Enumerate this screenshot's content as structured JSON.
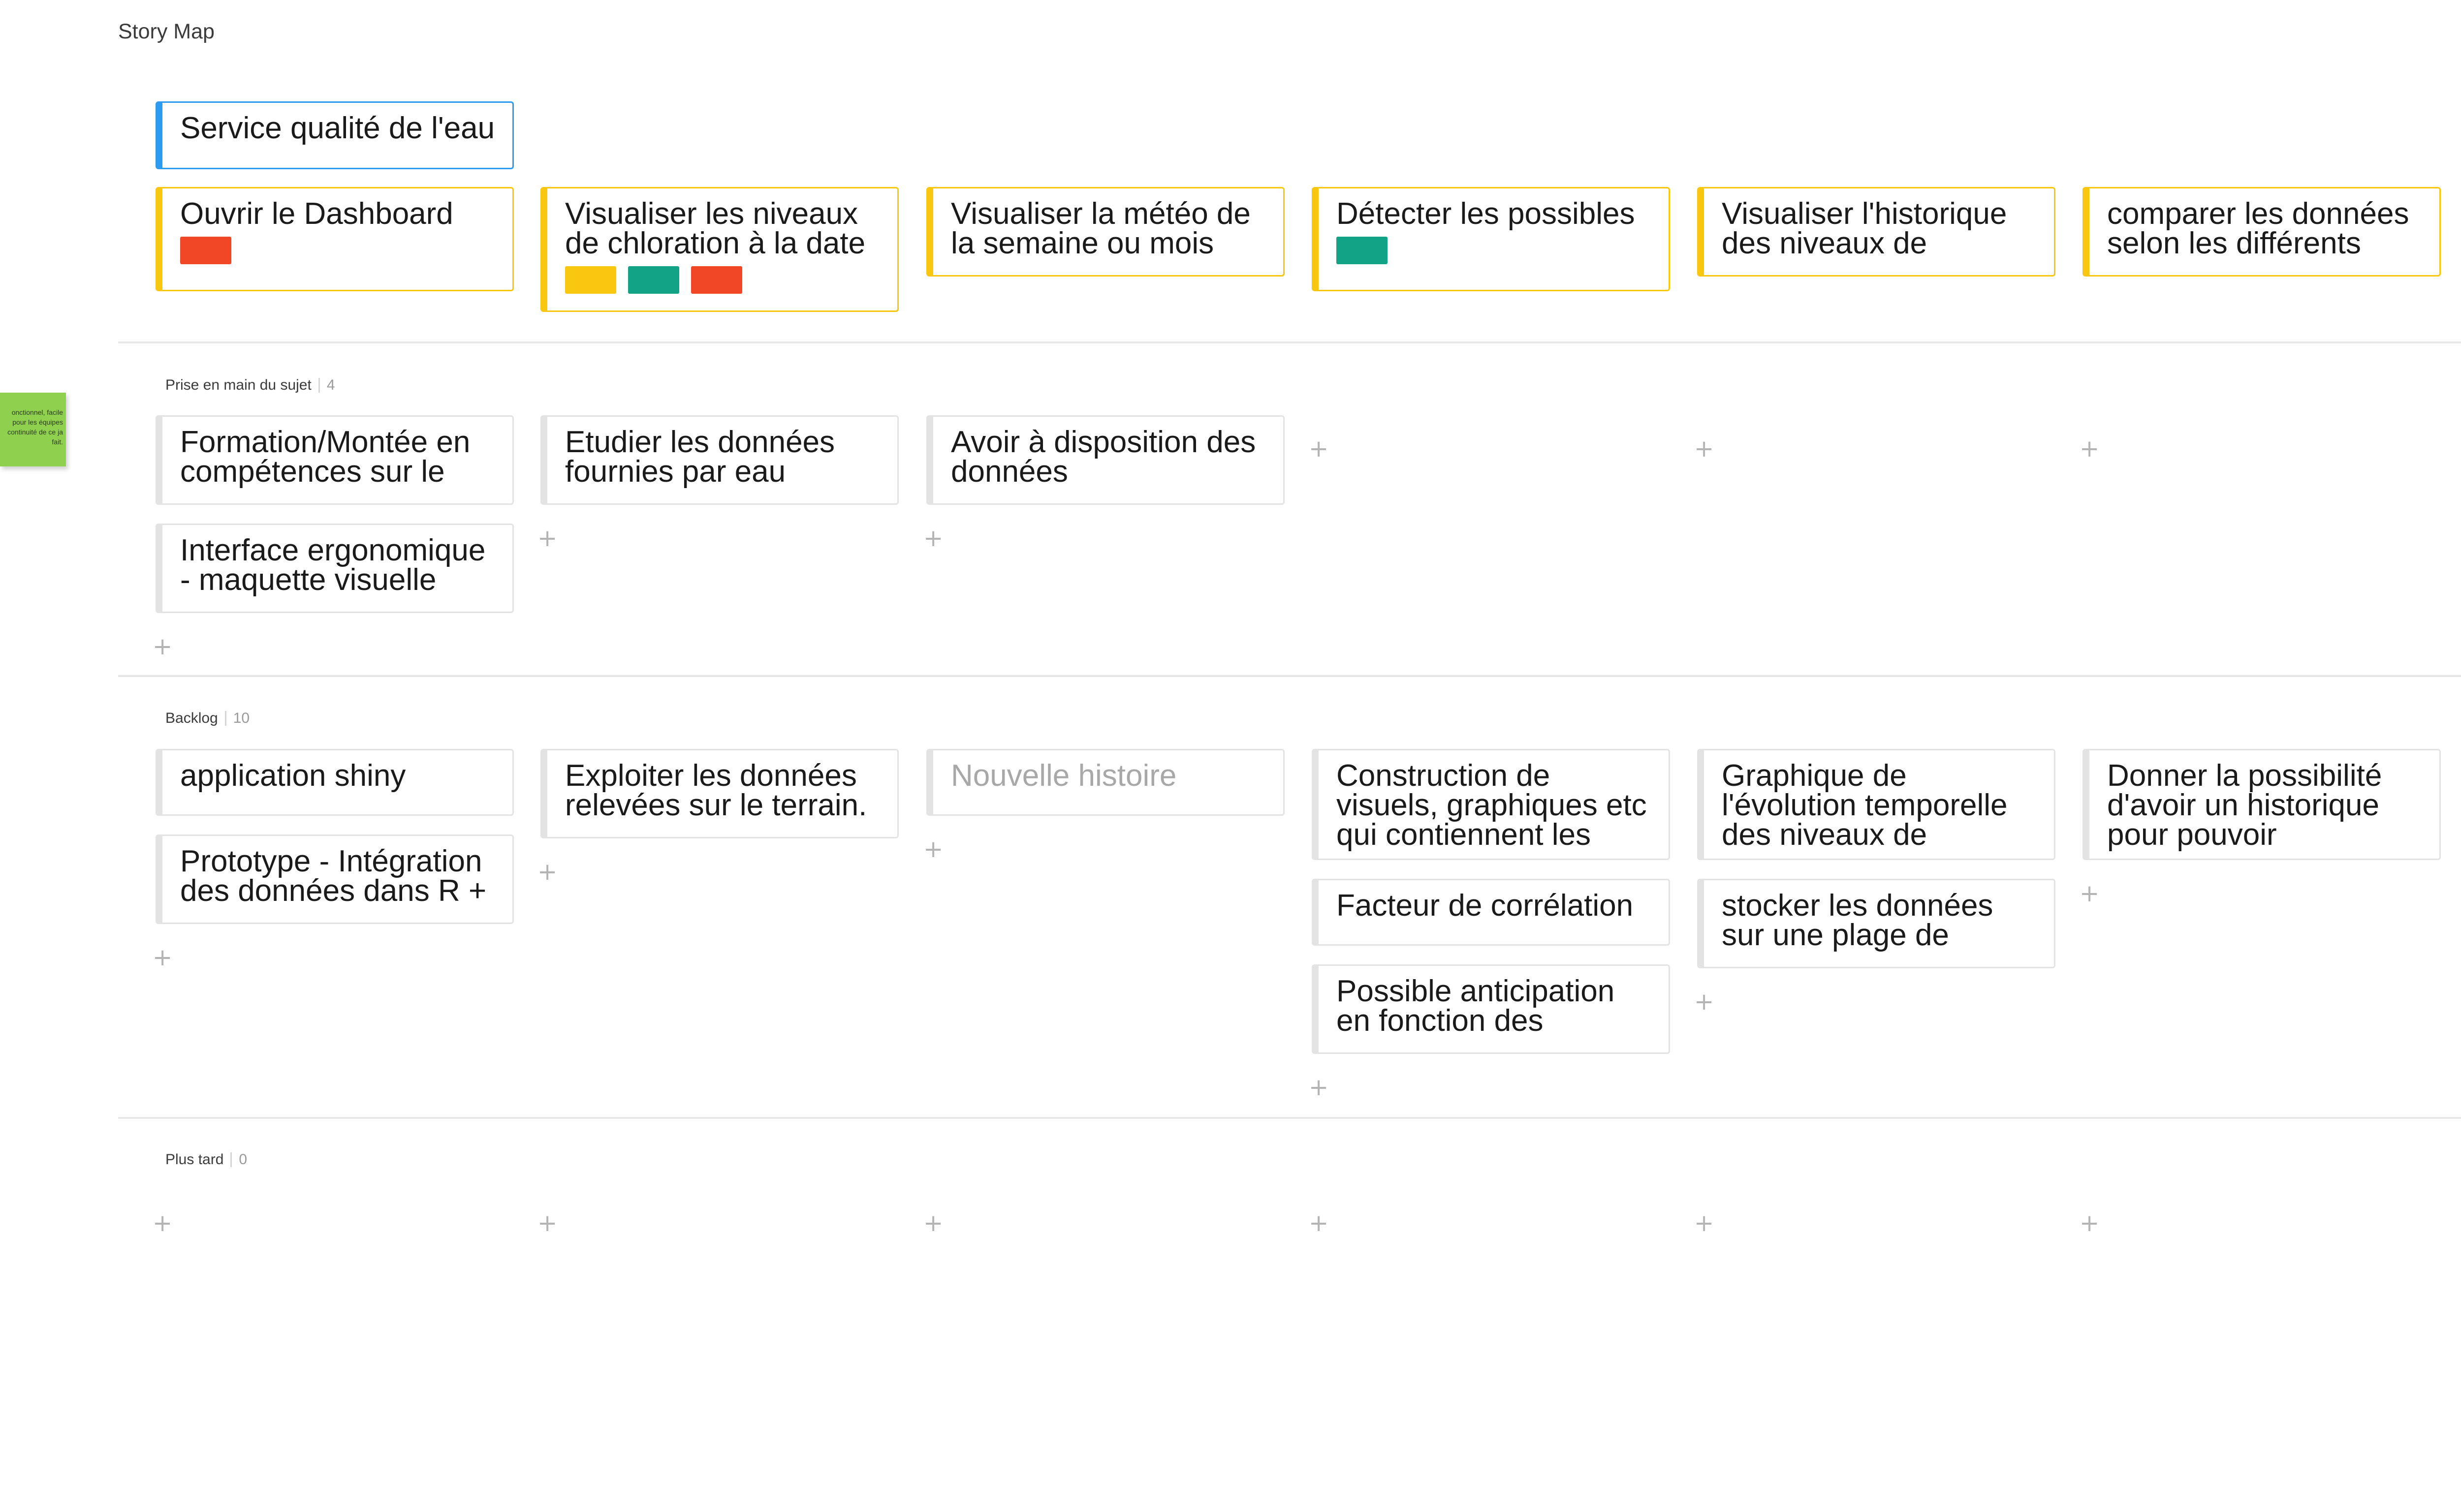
{
  "page": {
    "title": "Story Map"
  },
  "sticky_note": {
    "text": "onctionnel, facile pour les équipes continuité de ce ja fait."
  },
  "colors": {
    "activity_border": "#2d9bf0",
    "step_border": "#fac710",
    "story_border": "#e3e3e3",
    "tag_yellow": "#fac710",
    "tag_green": "#12a386",
    "tag_red": "#f24726",
    "sticky": "#8fd14f"
  },
  "activity": {
    "label": "Service qualité de l'eau"
  },
  "steps": [
    {
      "label": "Ouvrir le Dashboard",
      "tags": [
        "red"
      ]
    },
    {
      "label": "Visualiser les niveaux de chloration à la date",
      "tags": [
        "yellow",
        "green",
        "red"
      ]
    },
    {
      "label": "Visualiser la météo de la semaine ou mois",
      "tags": []
    },
    {
      "label": "Détecter les possibles",
      "tags": [
        "green"
      ]
    },
    {
      "label": "Visualiser l'historique des niveaux de",
      "tags": []
    },
    {
      "label": "comparer les données selon les différents",
      "tags": []
    }
  ],
  "releases": [
    {
      "name": "Prise en main du sujet",
      "count": "4",
      "columns": [
        [
          "Formation/Montée en compétences sur le",
          "Interface ergonomique - maquette visuelle"
        ],
        [
          "Etudier les données fournies par eau"
        ],
        [
          "Avoir à disposition des données"
        ],
        [],
        [],
        []
      ]
    },
    {
      "name": "Backlog",
      "count": "10",
      "columns": [
        [
          "application shiny",
          "Prototype - Intégration des données dans R +"
        ],
        [
          "Exploiter les données relevées sur le terrain."
        ],
        [
          "Nouvelle histoire"
        ],
        [
          "Construction de visuels, graphiques etc qui contiennent les",
          "Facteur de corrélation",
          "Possible anticipation en fonction des"
        ],
        [
          "Graphique de l'évolution temporelle des niveaux de",
          "stocker les données sur une plage de"
        ],
        [
          "Donner la possibilité d'avoir un historique pour pouvoir"
        ]
      ]
    },
    {
      "name": "Plus tard",
      "count": "0",
      "columns": [
        [],
        [],
        [],
        [],
        [],
        []
      ]
    }
  ],
  "add_symbol": "+"
}
